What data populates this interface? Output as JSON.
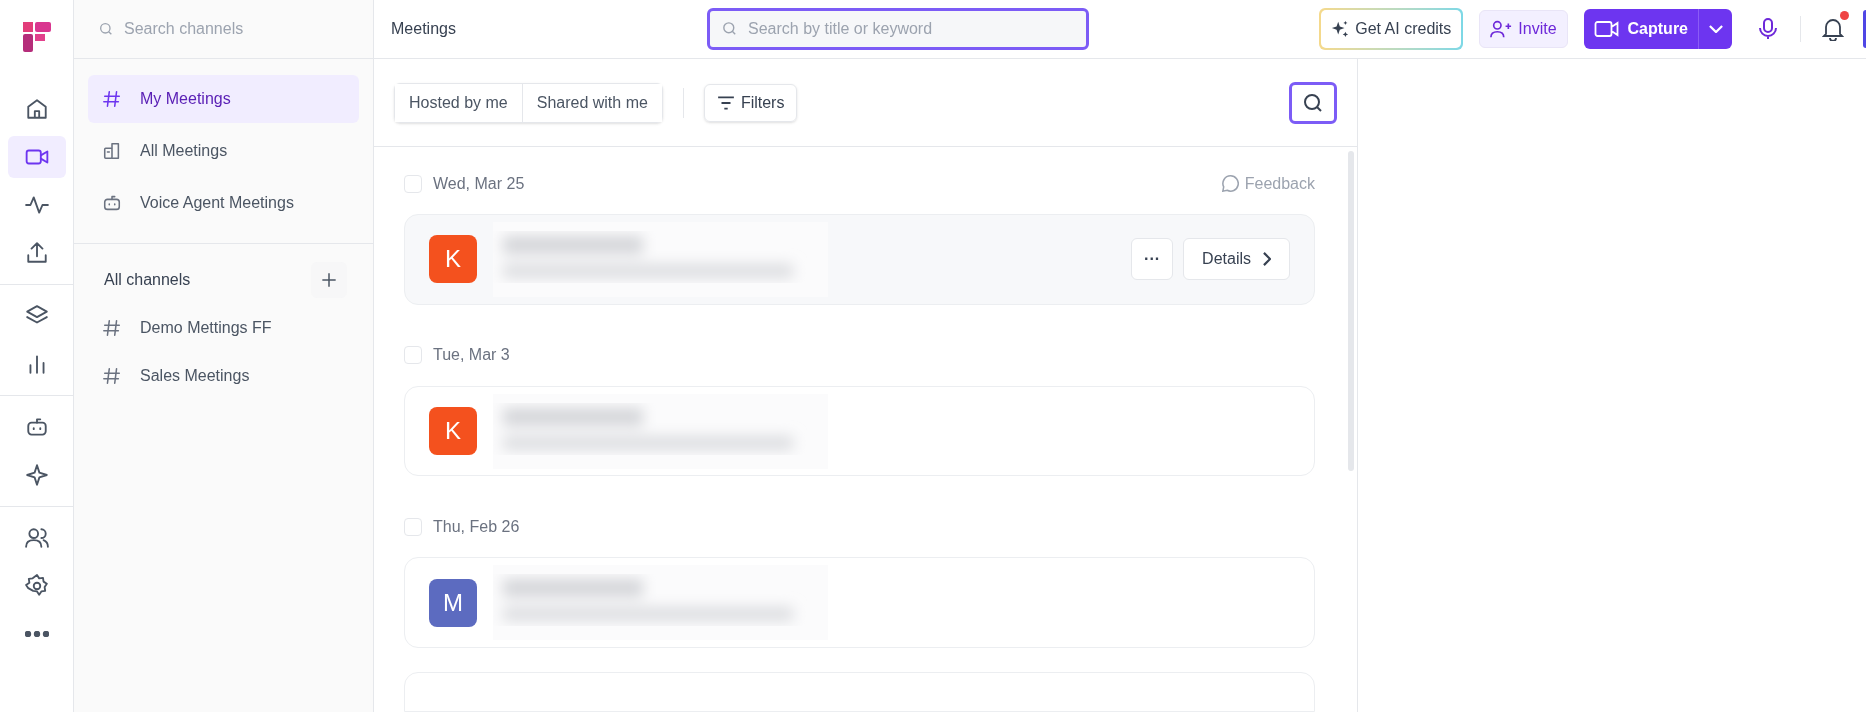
{
  "rail": [
    [
      {
        "kind": "home",
        "selected": false
      },
      {
        "kind": "video",
        "selected": true
      },
      {
        "kind": "pulse",
        "selected": false
      },
      {
        "kind": "upload",
        "selected": false
      }
    ],
    [
      {
        "kind": "layers",
        "selected": false
      },
      {
        "kind": "chart",
        "selected": false
      }
    ],
    [
      {
        "kind": "bot",
        "selected": false
      },
      {
        "kind": "sparkle",
        "selected": false
      }
    ],
    [
      {
        "kind": "users",
        "selected": false
      },
      {
        "kind": "gear",
        "selected": false
      },
      {
        "kind": "dots",
        "selected": false
      }
    ]
  ],
  "sidebar": {
    "search_placeholder": "Search channels",
    "items": [
      {
        "kind": "hash",
        "label": "My Meetings",
        "selected": true
      },
      {
        "kind": "building",
        "label": "All Meetings",
        "selected": false
      },
      {
        "kind": "bot",
        "label": "Voice Agent Meetings",
        "selected": false
      }
    ],
    "channels_heading": "All channels",
    "channels": [
      {
        "label": "Demo Mettings FF",
        "selected": false
      },
      {
        "label": "Sales Meetings",
        "selected": false
      }
    ]
  },
  "header": {
    "title": "Meetings",
    "search_placeholder": "Search by title or keyword",
    "ai_button": "Get AI credits",
    "invite_button": "Invite",
    "capture_button": "Capture",
    "has_notification": true
  },
  "toolbar": {
    "tabs": [
      {
        "label": "Hosted by me",
        "selected": false
      },
      {
        "label": "Shared with me",
        "selected": false
      }
    ],
    "filters_button": "Filters"
  },
  "feedback": "Feedback",
  "groups": [
    {
      "date": "Wed, Mar 25",
      "checked": false,
      "meetings": [
        {
          "initial": "K",
          "color": "#f4511e",
          "hovered": true,
          "more_button": "···",
          "details_button": "Details"
        }
      ]
    },
    {
      "date": "Tue, Mar 3",
      "checked": false,
      "meetings": [
        {
          "initial": "K",
          "color": "#f4511e",
          "hovered": false
        }
      ]
    },
    {
      "date": "Thu, Feb 26",
      "checked": false,
      "meetings": [
        {
          "initial": "M",
          "color": "#5c6bc0",
          "hovered": false
        }
      ]
    }
  ]
}
